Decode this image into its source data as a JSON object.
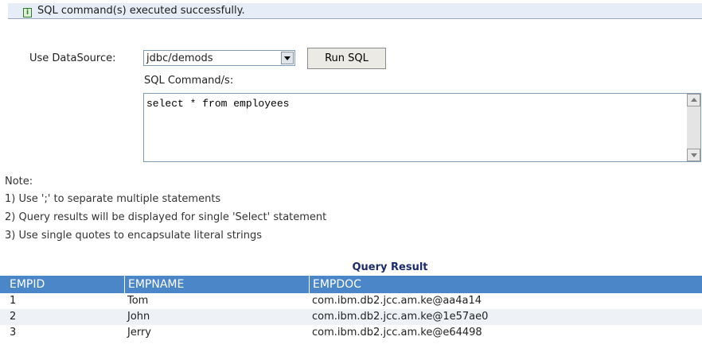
{
  "status": {
    "icon": "info-icon",
    "icon_glyph": "i",
    "message": "SQL command(s) executed successfully."
  },
  "form": {
    "datasource_label": "Use DataSource:",
    "datasource_value": "jdbc/demods",
    "run_button_label": "Run SQL",
    "sql_label": "SQL Command/s:",
    "sql_value": "select * from employees"
  },
  "notes": {
    "heading": "Note:",
    "items": [
      "1) Use ';' to separate multiple statements",
      "2) Query results will be displayed for single 'Select' statement",
      "3) Use single quotes to encapsulate literal strings"
    ]
  },
  "result": {
    "title": "Query Result",
    "columns": [
      "EMPID",
      "EMPNAME",
      "EMPDOC"
    ],
    "rows": [
      [
        "1",
        "Tom",
        "com.ibm.db2.jcc.am.ke@aa4a14"
      ],
      [
        "2",
        "John",
        "com.ibm.db2.jcc.am.ke@1e57ae0"
      ],
      [
        "3",
        "Jerry",
        "com.ibm.db2.jcc.am.ke@e64498"
      ]
    ]
  },
  "colors": {
    "header_bg": "#4a86c8",
    "title": "#1c2a6e",
    "status_bg": "#e6edf7"
  }
}
